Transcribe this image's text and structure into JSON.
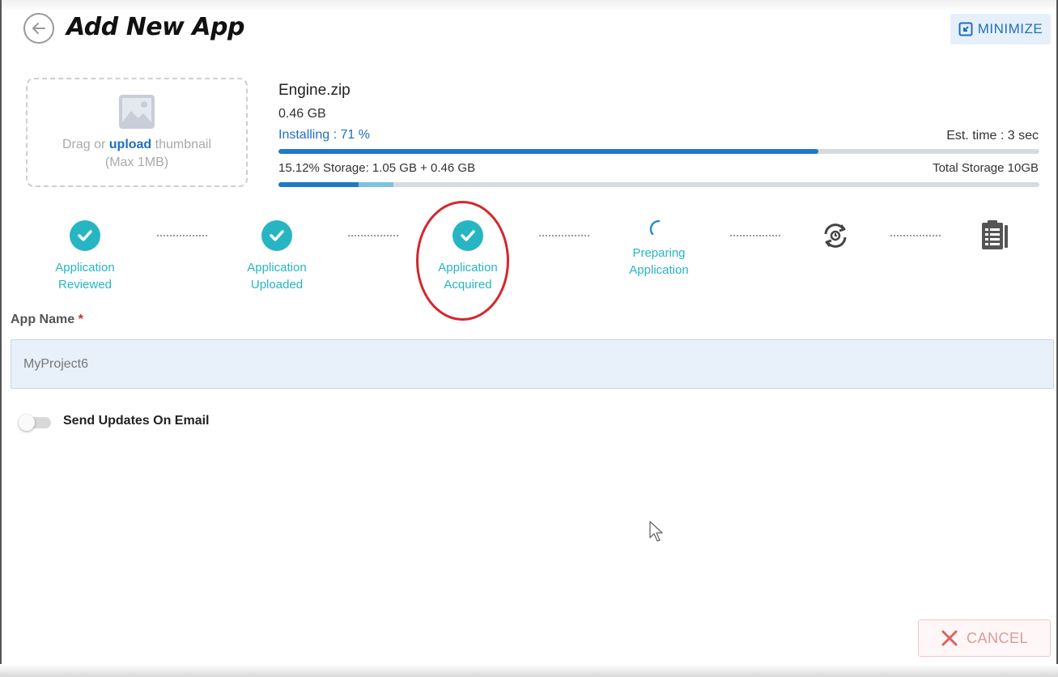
{
  "header": {
    "title": "Add New App",
    "minimize_label": "MINIMIZE"
  },
  "thumbnail": {
    "prefix": "Drag or",
    "link": "upload",
    "suffix": "thumbnail",
    "hint": "(Max 1MB)"
  },
  "file": {
    "name": "Engine.zip",
    "size": "0.46 GB",
    "status": "Installing : 71 %",
    "progress_percent": 71,
    "est_time": "Est. time : 3 sec"
  },
  "storage": {
    "text": "15.12% Storage: 1.05 GB + 0.46 GB",
    "total": "Total Storage 10GB",
    "used_percent": 10.5,
    "new_percent": 4.6
  },
  "steps": [
    {
      "line1": "Application",
      "line2": "Reviewed",
      "state": "done"
    },
    {
      "line1": "Application",
      "line2": "Uploaded",
      "state": "done"
    },
    {
      "line1": "Application",
      "line2": "Acquired",
      "state": "done"
    },
    {
      "line1": "Preparing",
      "line2": "Application",
      "state": "in-progress"
    },
    {
      "line1": "",
      "line2": "",
      "state": "pending",
      "icon": "sync-icon"
    },
    {
      "line1": "",
      "line2": "",
      "state": "pending",
      "icon": "checklist-icon"
    }
  ],
  "form": {
    "app_name_label": "App Name",
    "required_mark": "*",
    "app_name_value": "MyProject6",
    "email_toggle_label": "Send Updates On Email",
    "email_toggle_on": false
  },
  "footer": {
    "cancel_label": "CANCEL"
  },
  "colors": {
    "accent": "#27b5c4",
    "primary": "#1f78c8",
    "highlight": "#d6262b"
  }
}
